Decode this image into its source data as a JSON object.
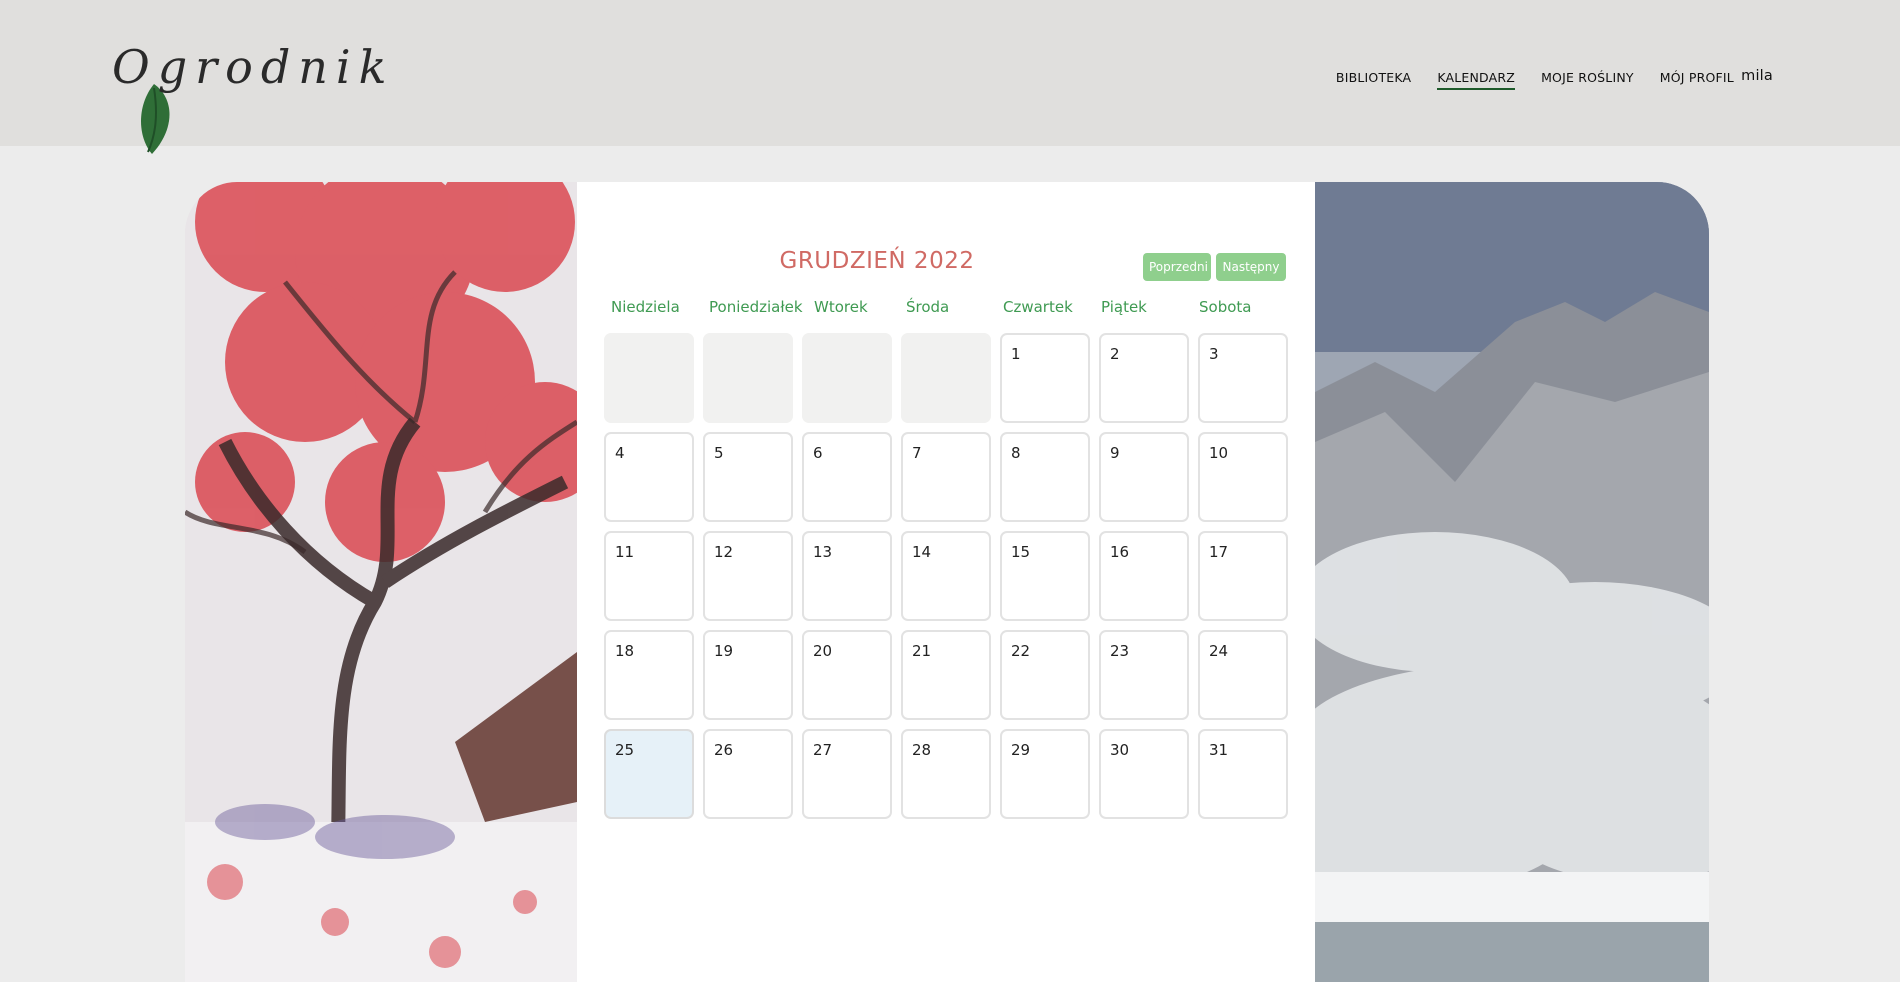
{
  "brand": {
    "logo_text": "Ogrodnik"
  },
  "nav": {
    "items": [
      {
        "label": "BIBLIOTEKA",
        "active": false
      },
      {
        "label": "KALENDARZ",
        "active": true
      },
      {
        "label": "MOJE ROŚLINY",
        "active": false
      },
      {
        "label": "MÓJ PROFIL",
        "active": false
      }
    ],
    "user": "mila"
  },
  "calendar": {
    "title": "GRUDZIEŃ 2022",
    "prev_label": "Poprzedni",
    "next_label": "Następny",
    "weekdays": [
      "Niedziela",
      "Poniedziałek",
      "Wtorek",
      "Środa",
      "Czwartek",
      "Piątek",
      "Sobota"
    ],
    "leading_empty_days": 4,
    "days": [
      "1",
      "2",
      "3",
      "4",
      "5",
      "6",
      "7",
      "8",
      "9",
      "10",
      "11",
      "12",
      "13",
      "14",
      "15",
      "16",
      "17",
      "18",
      "19",
      "20",
      "21",
      "22",
      "23",
      "24",
      "25",
      "26",
      "27",
      "28",
      "29",
      "30",
      "31"
    ],
    "highlighted_day": "25"
  },
  "colors": {
    "accent_green": "#3f9a52",
    "title_red": "#d06a64",
    "button_green": "#8fcf8d",
    "today_bg": "#e6f1f8"
  }
}
